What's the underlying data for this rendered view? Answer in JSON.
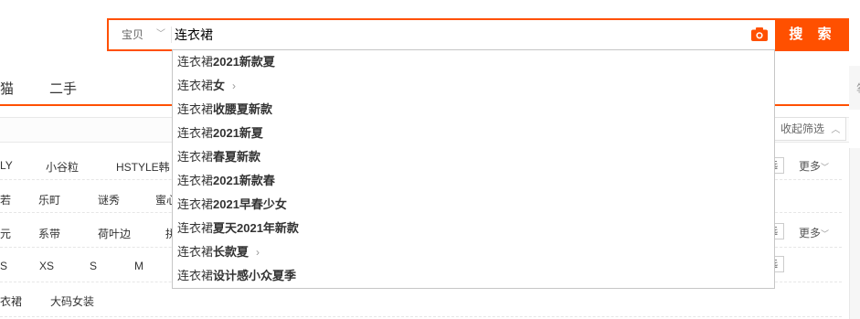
{
  "search": {
    "scope_label": "宝贝",
    "query": "连衣裙",
    "button_label": "搜 索"
  },
  "tabs": [
    {
      "label": "猫"
    },
    {
      "label": "二手"
    }
  ],
  "right_edge_char": "筝",
  "filter": {
    "collapse_label": "收起筛选",
    "more_label": "更多",
    "multi_label": "选",
    "rows": [
      {
        "items": [
          "LY",
          "小谷粒",
          "HSTYLE韩"
        ]
      },
      {
        "items": [
          "若",
          "乐町",
          "谜秀",
          "蜜心"
        ]
      },
      {
        "items": [
          "元",
          "系带",
          "荷叶边",
          "拼"
        ]
      },
      {
        "items": [
          "S",
          "XS",
          "S",
          "M"
        ]
      },
      {
        "items": [
          "衣裙",
          "大码女装"
        ]
      }
    ]
  },
  "suggestions": [
    {
      "prefix": "连衣裙",
      "suffix": "2021新款夏",
      "has_arrow": false
    },
    {
      "prefix": "连衣裙",
      "suffix": "女",
      "has_arrow": true
    },
    {
      "prefix": "连衣裙",
      "suffix": "收腰夏新款",
      "has_arrow": false
    },
    {
      "prefix": "连衣裙",
      "suffix": "2021新夏",
      "has_arrow": false
    },
    {
      "prefix": "连衣裙",
      "suffix": "春夏新款",
      "has_arrow": false
    },
    {
      "prefix": "连衣裙",
      "suffix": "2021新款春",
      "has_arrow": false
    },
    {
      "prefix": "连衣裙",
      "suffix": "2021早春少女",
      "has_arrow": false
    },
    {
      "prefix": "连衣裙",
      "suffix": "夏天2021年新款",
      "has_arrow": false
    },
    {
      "prefix": "连衣裙",
      "suffix": "长款夏",
      "has_arrow": true
    },
    {
      "prefix": "连衣裙",
      "suffix": "设计感小众夏季",
      "has_arrow": false
    }
  ],
  "colors": {
    "accent": "#ff5000"
  }
}
